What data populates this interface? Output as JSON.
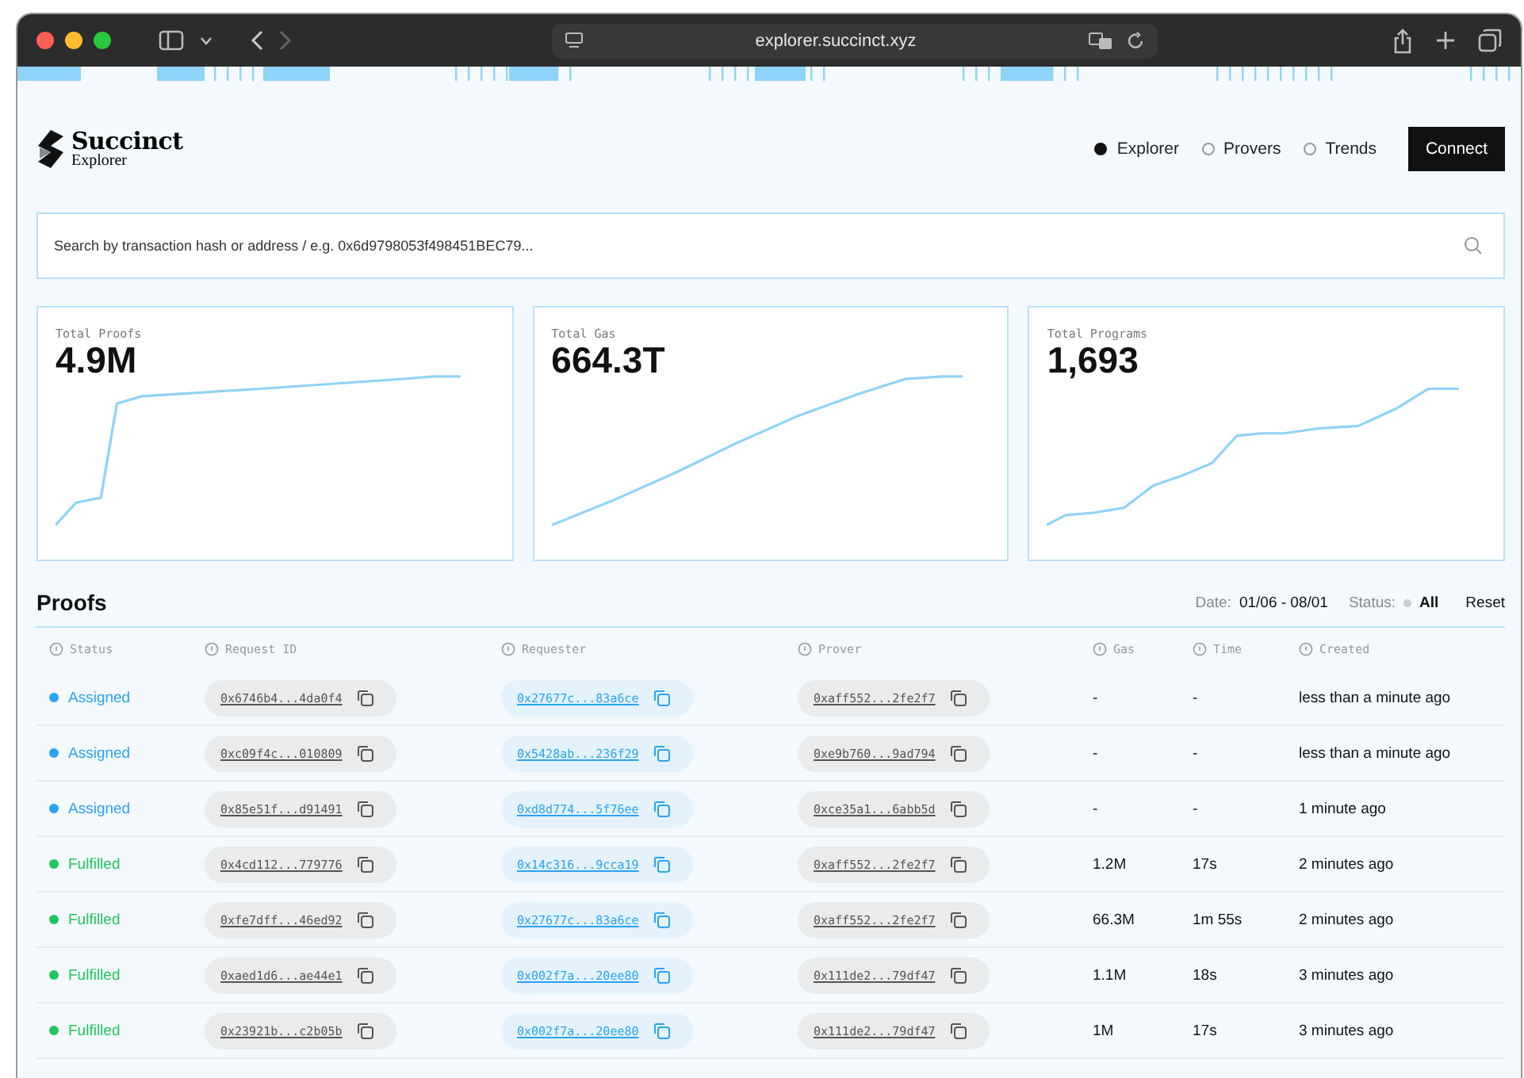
{
  "browser": {
    "url": "explorer.succinct.xyz"
  },
  "header": {
    "logo_title": "Succinct",
    "logo_subtitle": "Explorer",
    "nav": [
      {
        "label": "Explorer",
        "selected": true
      },
      {
        "label": "Provers",
        "selected": false
      },
      {
        "label": "Trends",
        "selected": false
      }
    ],
    "connect_button": "Connect"
  },
  "search": {
    "placeholder": "Search by transaction hash or address / e.g. 0x6d9798053f498451BEC79..."
  },
  "stats": [
    {
      "label": "Total Proofs",
      "value": "4.9M"
    },
    {
      "label": "Total Gas",
      "value": "664.3T"
    },
    {
      "label": "Total Programs",
      "value": "1,693"
    }
  ],
  "proofs": {
    "title": "Proofs",
    "date_label": "Date:",
    "date_value": "01/06 - 08/01",
    "status_label": "Status:",
    "status_value": "All",
    "reset": "Reset",
    "columns": [
      "Status",
      "Request ID",
      "Requester",
      "Prover",
      "Gas",
      "Time",
      "Created"
    ],
    "rows": [
      {
        "status": "Assigned",
        "color": "#2ba3f0",
        "request_id": "0x6746b4...4da0f4",
        "requester": "0x27677c...83a6ce",
        "prover": "0xaff552...2fe2f7",
        "gas": "-",
        "time": "-",
        "created": "less than a minute ago"
      },
      {
        "status": "Assigned",
        "color": "#2ba3f0",
        "request_id": "0xc09f4c...010809",
        "requester": "0x5428ab...236f29",
        "prover": "0xe9b760...9ad794",
        "gas": "-",
        "time": "-",
        "created": "less than a minute ago"
      },
      {
        "status": "Assigned",
        "color": "#2ba3f0",
        "request_id": "0x85e51f...d91491",
        "requester": "0xd8d774...5f76ee",
        "prover": "0xce35a1...6abb5d",
        "gas": "-",
        "time": "-",
        "created": "1 minute ago"
      },
      {
        "status": "Fulfilled",
        "color": "#22c55e",
        "request_id": "0x4cd112...779776",
        "requester": "0x14c316...9cca19",
        "prover": "0xaff552...2fe2f7",
        "gas": "1.2M",
        "time": "17s",
        "created": "2 minutes ago"
      },
      {
        "status": "Fulfilled",
        "color": "#22c55e",
        "request_id": "0xfe7dff...46ed92",
        "requester": "0x27677c...83a6ce",
        "prover": "0xaff552...2fe2f7",
        "gas": "66.3M",
        "time": "1m 55s",
        "created": "2 minutes ago"
      },
      {
        "status": "Fulfilled",
        "color": "#22c55e",
        "request_id": "0xaed1d6...ae44e1",
        "requester": "0x002f7a...20ee80",
        "prover": "0x111de2...79df47",
        "gas": "1.1M",
        "time": "18s",
        "created": "3 minutes ago"
      },
      {
        "status": "Fulfilled",
        "color": "#22c55e",
        "request_id": "0x23921b...c2b05b",
        "requester": "0x002f7a...20ee80",
        "prover": "0x111de2...79df47",
        "gas": "1M",
        "time": "17s",
        "created": "3 minutes ago"
      }
    ]
  }
}
